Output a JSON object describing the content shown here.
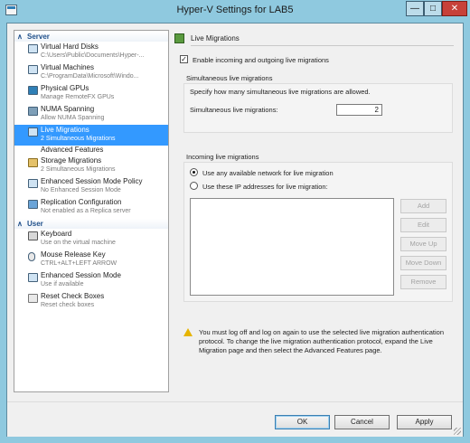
{
  "window": {
    "title": "Hyper-V Settings for LAB5",
    "controls": {
      "minimize": "—",
      "maximize": "□",
      "close": "✕"
    }
  },
  "sidebar": {
    "server_header": "Server",
    "server_items": [
      {
        "title": "Virtual Hard Disks",
        "subtitle": "C:\\Users\\Public\\Documents\\Hyper-...",
        "icon": "virtual-hard-disk-icon"
      },
      {
        "title": "Virtual Machines",
        "subtitle": "C:\\ProgramData\\Microsoft\\Windo...",
        "icon": "virtual-machine-icon"
      },
      {
        "title": "Physical GPUs",
        "subtitle": "Manage RemoteFX GPUs",
        "icon": "gpu-icon"
      },
      {
        "title": "NUMA Spanning",
        "subtitle": "Allow NUMA Spanning",
        "icon": "numa-icon"
      },
      {
        "title": "Live Migrations",
        "subtitle": "2 Simultaneous Migrations",
        "icon": "live-migration-icon",
        "selected": true
      },
      {
        "title": "Advanced Features",
        "subtitle": "",
        "icon": ""
      },
      {
        "title": "Storage Migrations",
        "subtitle": "2 Simultaneous Migrations",
        "icon": "storage-migration-icon"
      },
      {
        "title": "Enhanced Session Mode Policy",
        "subtitle": "No Enhanced Session Mode",
        "icon": "session-policy-icon"
      },
      {
        "title": "Replication Configuration",
        "subtitle": "Not enabled as a Replica server",
        "icon": "replication-icon"
      }
    ],
    "user_header": "User",
    "user_items": [
      {
        "title": "Keyboard",
        "subtitle": "Use on the virtual machine",
        "icon": "keyboard-icon"
      },
      {
        "title": "Mouse Release Key",
        "subtitle": "CTRL+ALT+LEFT ARROW",
        "icon": "mouse-icon"
      },
      {
        "title": "Enhanced Session Mode",
        "subtitle": "Use if available",
        "icon": "session-mode-icon"
      },
      {
        "title": "Reset Check Boxes",
        "subtitle": "Reset check boxes",
        "icon": "reset-icon"
      }
    ]
  },
  "pane": {
    "title": "Live Migrations",
    "enable_label": "Enable incoming and outgoing live migrations",
    "enable_checked": true,
    "simultaneous": {
      "group_label": "Simultaneous live migrations",
      "description": "Specify how many simultaneous live migrations are allowed.",
      "field_label": "Simultaneous live migrations:",
      "value": "2"
    },
    "incoming": {
      "group_label": "Incoming live migrations",
      "option_any": "Use any available network for live migration",
      "option_ip": "Use these IP addresses for live migration:",
      "selected": "any",
      "buttons": [
        "Add",
        "Edit",
        "Move Up",
        "Move Down",
        "Remove"
      ]
    },
    "warning": "You must log off and log on again to use the selected live migration authentication protocol. To change the live migration authentication protocol, expand the Live Migration page and then select the Advanced Features page."
  },
  "footer": {
    "ok": "OK",
    "cancel": "Cancel",
    "apply": "Apply"
  }
}
